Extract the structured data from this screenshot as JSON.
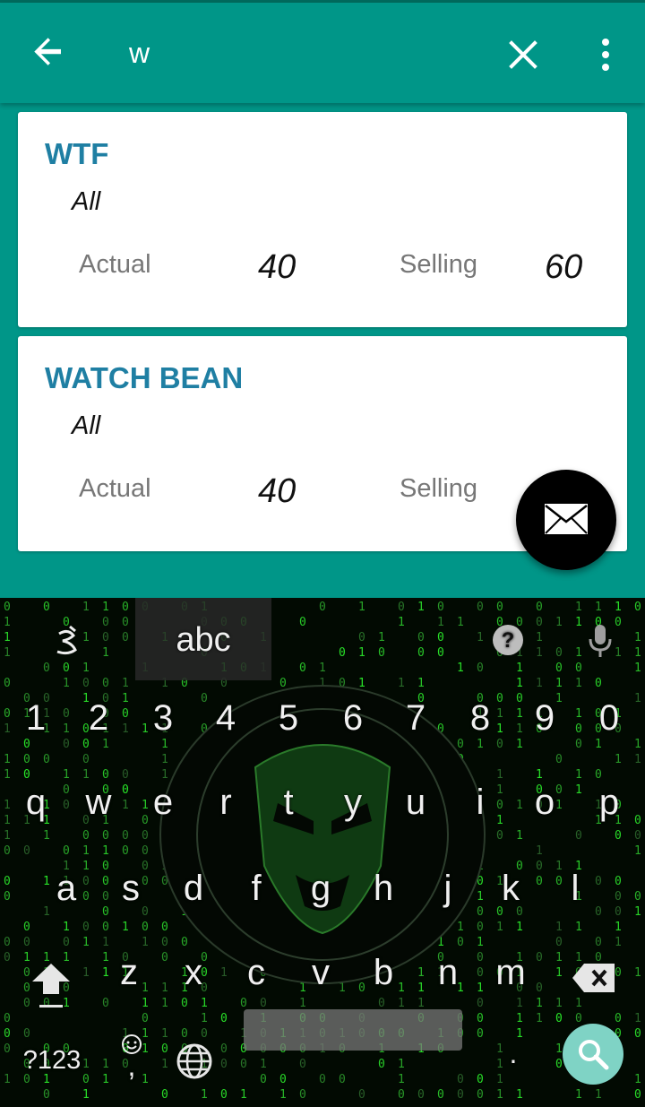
{
  "search": {
    "query": "w"
  },
  "results": [
    {
      "name": "WTF",
      "category": "All",
      "actual_label": "Actual",
      "actual_value": "40",
      "selling_label": "Selling",
      "selling_value": "60"
    },
    {
      "name": "WATCH BEAN",
      "category": "All",
      "actual_label": "Actual",
      "actual_value": "40",
      "selling_label": "Selling",
      "selling_value": ""
    }
  ],
  "keyboard": {
    "tab_abc": "abc",
    "numbers": [
      "1",
      "2",
      "3",
      "4",
      "5",
      "6",
      "7",
      "8",
      "9",
      "0"
    ],
    "row1": [
      "q",
      "w",
      "e",
      "r",
      "t",
      "y",
      "u",
      "i",
      "o",
      "p"
    ],
    "row2": [
      "a",
      "s",
      "d",
      "f",
      "g",
      "h",
      "j",
      "k",
      "l"
    ],
    "row3": [
      "z",
      "x",
      "c",
      "v",
      "b",
      "n",
      "m"
    ],
    "symbols_label": "?123",
    "comma": ",",
    "period": "."
  },
  "icons": {
    "back": "arrow-left-icon",
    "clear": "close-icon",
    "more": "more-vert-icon",
    "fab": "mail-icon",
    "handwriting": "handwriting-icon",
    "help": "help-icon",
    "mic": "mic-icon",
    "shift": "shift-icon",
    "backspace": "backspace-icon",
    "emoji": "emoji-icon",
    "globe": "globe-icon",
    "search": "search-icon"
  },
  "colors": {
    "primary": "#009688",
    "title": "#1f7fa3",
    "search_key": "#7fd3c5"
  }
}
